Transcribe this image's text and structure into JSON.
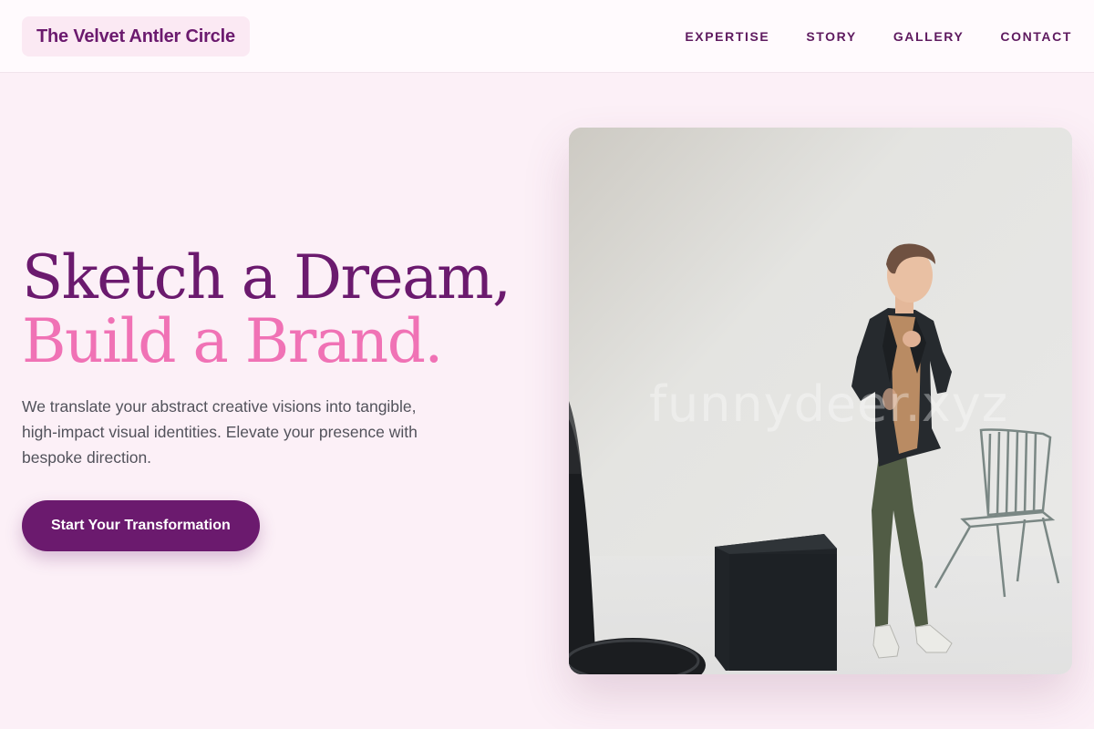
{
  "header": {
    "brand": "The Velvet Antler Circle",
    "nav": [
      {
        "label": "EXPERTISE"
      },
      {
        "label": "STORY"
      },
      {
        "label": "GALLERY"
      },
      {
        "label": "CONTACT"
      }
    ]
  },
  "hero": {
    "headline_line1": "Sketch a Dream,",
    "headline_line2": "Build a Brand.",
    "subtext": "We translate your abstract creative visions into tangible, high-impact visual identities. Elevate your presence with bespoke direction.",
    "cta_label": "Start Your Transformation",
    "image": {
      "description_icon": "photo-man-in-blazer-studio",
      "watermark": "funnydeer.xyz"
    }
  },
  "colors": {
    "accent_primary": "#6b1a6e",
    "accent_pink": "#f072b5",
    "background": "#fcf0f7"
  }
}
